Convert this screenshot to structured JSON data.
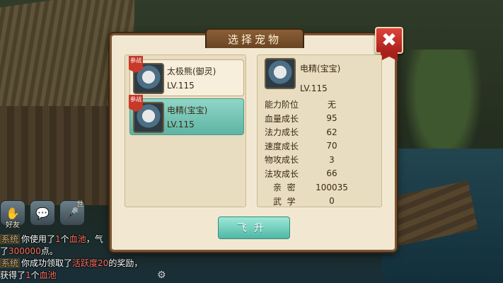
{
  "dialog": {
    "title": "选择宠物",
    "close_label": "✖",
    "fly_label": "飞升"
  },
  "pets": [
    {
      "badge": "参战",
      "name": "太极熊(御灵)",
      "level": "LV.115",
      "active": false
    },
    {
      "badge": "参战",
      "name": "电精(宝宝)",
      "level": "LV.115",
      "active": true
    }
  ],
  "detail": {
    "name": "电精(宝宝)",
    "level": "LV.115",
    "stats": [
      {
        "label": "能力阶位",
        "value": "无"
      },
      {
        "label": "血量成长",
        "value": "95"
      },
      {
        "label": "法力成长",
        "value": "62"
      },
      {
        "label": "速度成长",
        "value": "70"
      },
      {
        "label": "物攻成长",
        "value": "3"
      },
      {
        "label": "法攻成长",
        "value": "66"
      },
      {
        "label": "亲  密",
        "value": "100035"
      },
      {
        "label": "武  学",
        "value": "0"
      }
    ]
  },
  "hud": {
    "friend_label": "好友",
    "mic_label": "世"
  },
  "chat": {
    "line1_tag": "系统",
    "line1_a": "你使用了",
    "line1_num": "1",
    "line1_b": "个",
    "line1_item": "血池",
    "line1_c": "，气",
    "line2_a": "了",
    "line2_num": "300000",
    "line2_b": "点。",
    "line3_tag": "系统",
    "line3_a": "你成功领取了",
    "line3_item": "活跃度20",
    "line3_b": "的奖励，",
    "line4_a": "获得了",
    "line4_num": "1",
    "line4_b": "个",
    "line4_item": "血池"
  }
}
